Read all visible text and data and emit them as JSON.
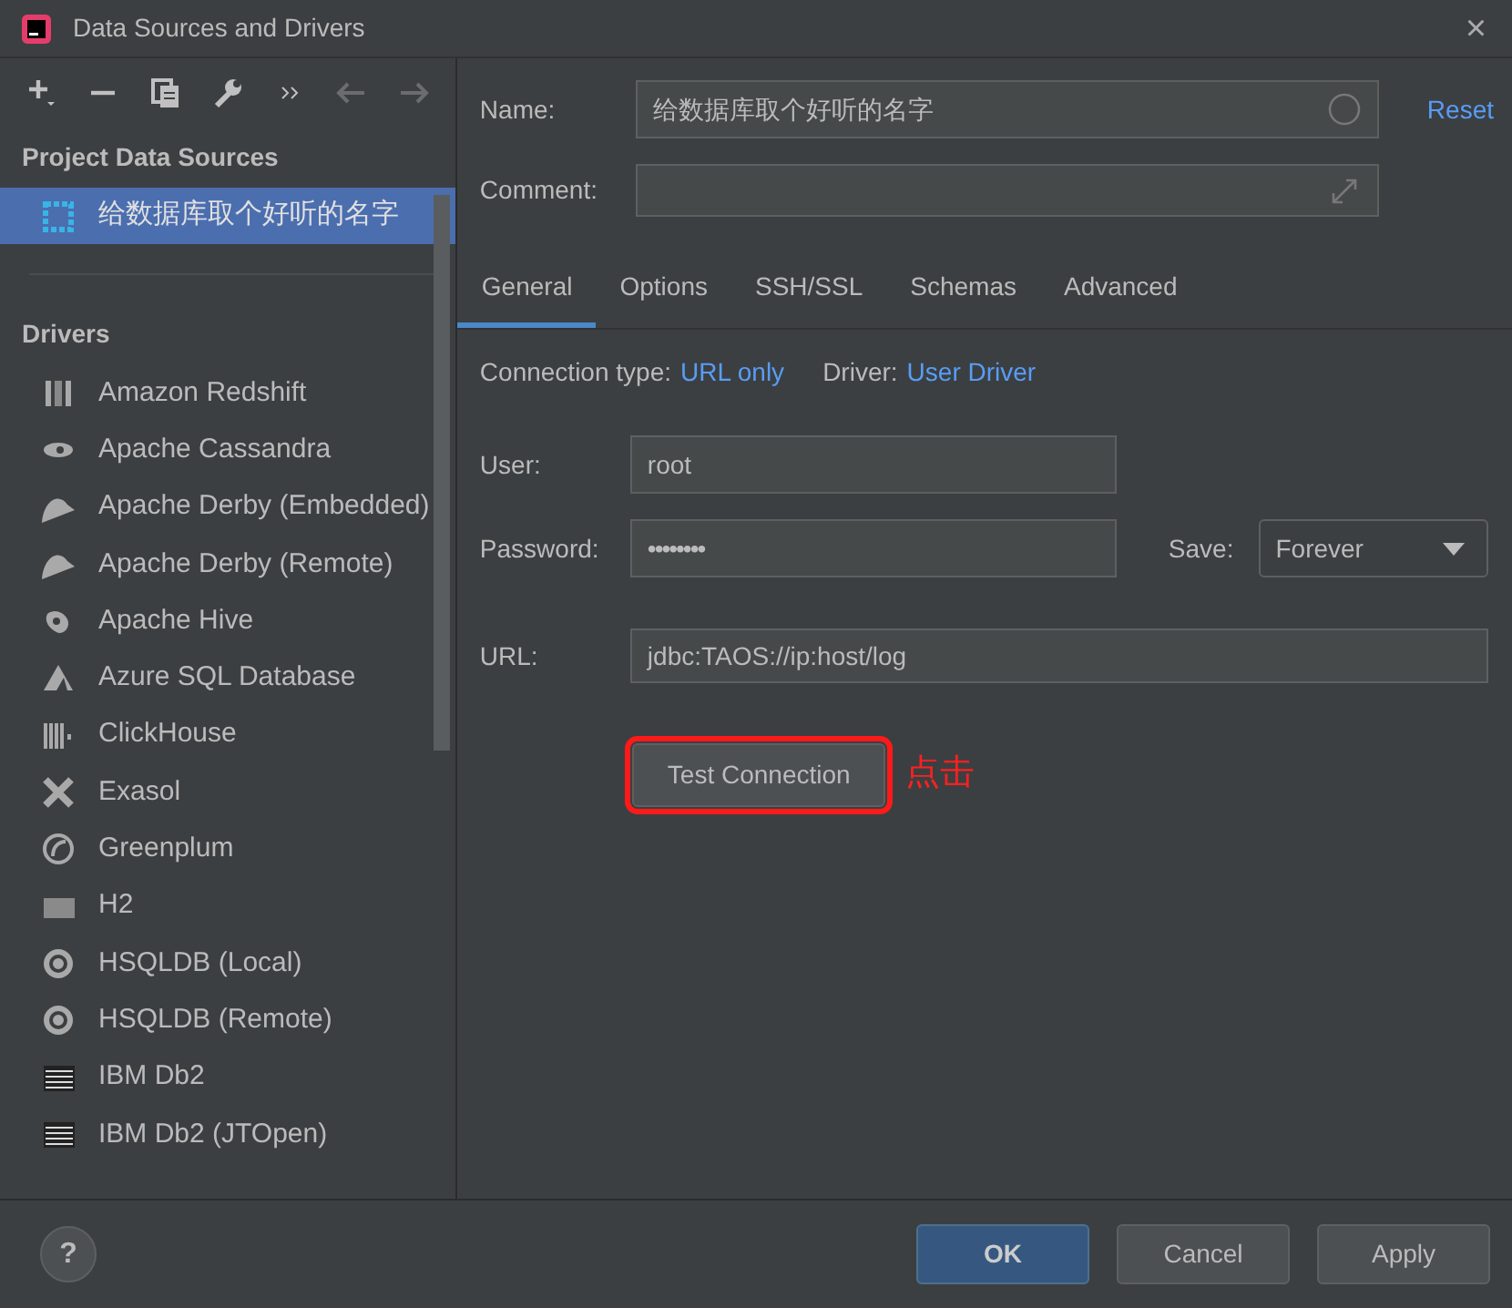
{
  "window": {
    "title": "Data Sources and Drivers",
    "close": "×"
  },
  "toolbar": [
    {
      "kind": "add",
      "disabled": false
    },
    {
      "kind": "remove",
      "disabled": false
    },
    {
      "kind": "copy",
      "disabled": false
    },
    {
      "kind": "wrench",
      "disabled": false
    },
    {
      "kind": "more",
      "disabled": false
    },
    {
      "kind": "back",
      "disabled": true
    },
    {
      "kind": "forward",
      "disabled": true
    }
  ],
  "sidebar": {
    "project_heading": "Project Data Sources",
    "project_items": [
      {
        "label": "给数据库取个好听的名字",
        "selected": true
      }
    ],
    "drivers_heading": "Drivers",
    "drivers": [
      {
        "label": "Amazon Redshift"
      },
      {
        "label": "Apache Cassandra"
      },
      {
        "label": "Apache Derby (Embedded)"
      },
      {
        "label": "Apache Derby (Remote)"
      },
      {
        "label": "Apache Hive"
      },
      {
        "label": "Azure SQL Database"
      },
      {
        "label": "ClickHouse"
      },
      {
        "label": "Exasol"
      },
      {
        "label": "Greenplum"
      },
      {
        "label": "H2"
      },
      {
        "label": "HSQLDB (Local)"
      },
      {
        "label": "HSQLDB (Remote)"
      },
      {
        "label": "IBM Db2"
      },
      {
        "label": "IBM Db2 (JTOpen)"
      }
    ]
  },
  "form": {
    "name_label": "Name:",
    "name_value": "给数据库取个好听的名字",
    "reset": "Reset",
    "comment_label": "Comment:",
    "tabs": [
      {
        "label": "General",
        "selected": true
      },
      {
        "label": "Options",
        "selected": false
      },
      {
        "label": "SSH/SSL",
        "selected": false
      },
      {
        "label": "Schemas",
        "selected": false
      },
      {
        "label": "Advanced",
        "selected": false
      }
    ],
    "connection_type_label": "Connection type:",
    "connection_type": "URL only",
    "driver_label": "Driver:",
    "driver": "User Driver",
    "user_label": "User:",
    "user_value": "root",
    "password_label": "Password:",
    "password_value": "••••••••",
    "save_label": "Save:",
    "save_value": "Forever",
    "url_label": "URL:",
    "url_value": "jdbc:TAOS://ip:host/log",
    "test_button": "Test Connection",
    "test_highlighted": true,
    "annotation": "点击"
  },
  "footer": {
    "help": "?",
    "buttons": [
      {
        "label": "OK",
        "primary": true
      },
      {
        "label": "Cancel",
        "primary": false
      },
      {
        "label": "Apply",
        "primary": false
      }
    ]
  }
}
